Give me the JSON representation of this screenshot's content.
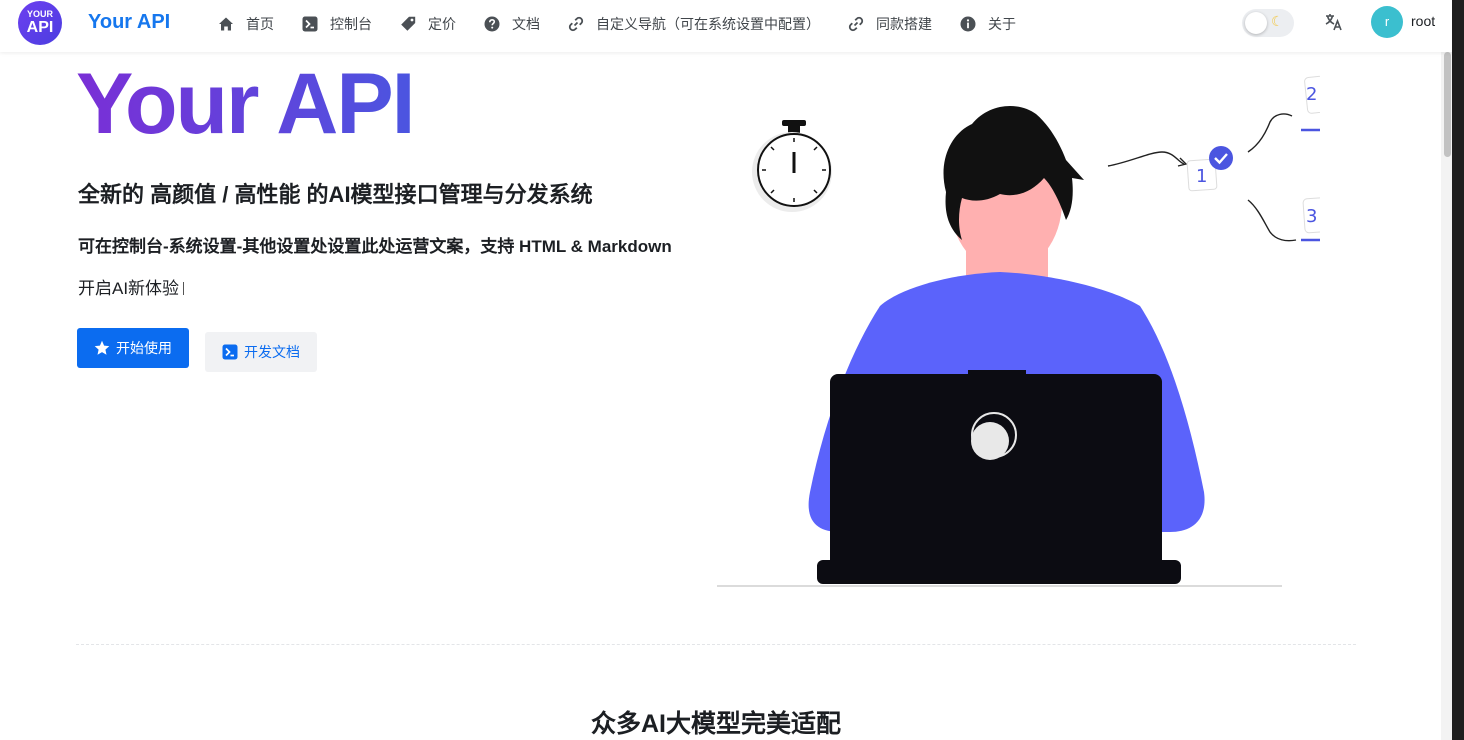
{
  "nav": {
    "logo_line1": "YOUR",
    "logo_line2": "API",
    "brand": "Your API",
    "items": [
      {
        "label": "首页",
        "icon": "home-icon"
      },
      {
        "label": "控制台",
        "icon": "terminal-icon"
      },
      {
        "label": "定价",
        "icon": "price-tag-icon"
      },
      {
        "label": "文档",
        "icon": "help-circle-icon"
      },
      {
        "label": "自定义导航（可在系统设置中配置）",
        "icon": "link-icon"
      },
      {
        "label": "同款搭建",
        "icon": "link-icon"
      },
      {
        "label": "关于",
        "icon": "info-circle-icon"
      }
    ],
    "theme_toggle_icon": "moon-icon",
    "language_icon": "translate-icon",
    "avatar_letter": "r",
    "username": "root"
  },
  "hero": {
    "title": "Your API",
    "subtitle": "全新的 高颜值 / 高性能 的AI模型接口管理与分发系统",
    "description": "可在控制台-系统设置-其他设置处设置此处运营文案，支持 HTML & Markdown",
    "typing_text": "开启AI新体验",
    "primary_button": "开始使用",
    "secondary_button": "开发文档",
    "illustration_steps": [
      "1",
      "2",
      "3"
    ]
  },
  "section": {
    "title": "众多AI大模型完美适配"
  },
  "colors": {
    "brand_blue": "#1677ee",
    "primary_button": "#0b6cf0",
    "title_gradient_start": "#7a2fd6",
    "title_gradient_end": "#4b55e0",
    "shirt": "#5b63fb",
    "avatar_bg": "#3bbfcf"
  }
}
